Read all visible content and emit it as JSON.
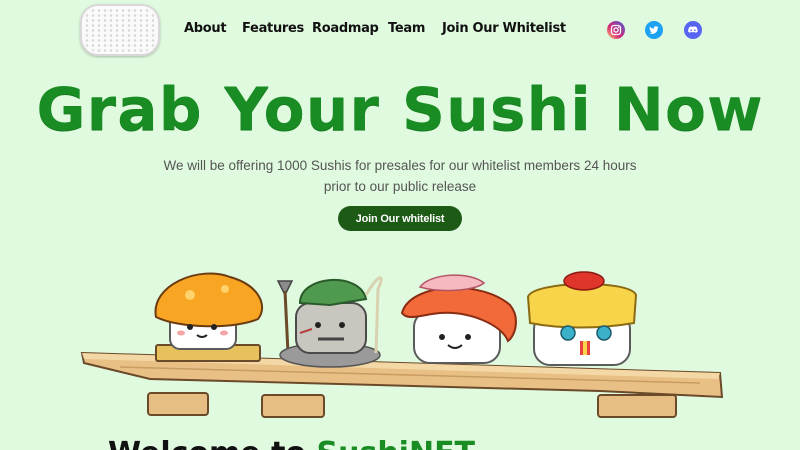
{
  "header": {
    "nav": [
      {
        "label": "About",
        "name": "nav-about"
      },
      {
        "label": "Features",
        "name": "nav-features"
      },
      {
        "label": "Roadmap",
        "name": "nav-roadmap"
      },
      {
        "label": "Team",
        "name": "nav-team"
      },
      {
        "label": "Join Our Whitelist",
        "name": "nav-join-whitelist"
      }
    ],
    "social": [
      {
        "icon": "instagram-icon",
        "color": "#d6249f"
      },
      {
        "icon": "twitter-icon",
        "color": "#1da1f2"
      },
      {
        "icon": "discord-icon",
        "color": "#5865f2"
      }
    ]
  },
  "hero": {
    "title": "Grab Your Sushi Now",
    "subtitle": "We will be offering 1000 Sushis for presales for our whitelist members 24 hours prior to our public release",
    "cta_label": "Join Our whitelist"
  },
  "next_section": {
    "heading_start": "Welcome to",
    "heading_accent": "SushiNFT"
  },
  "colors": {
    "background": "#dffade",
    "brand_green": "#1a8c24",
    "button": "#1c5a16"
  }
}
